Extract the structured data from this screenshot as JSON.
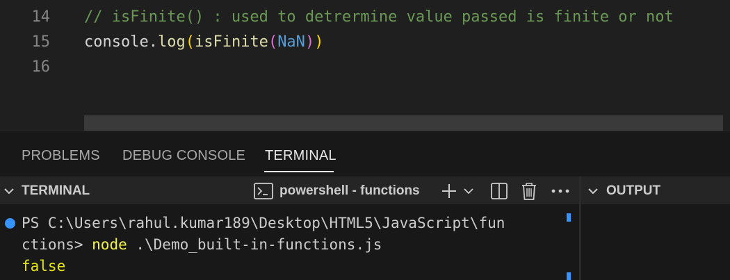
{
  "editor": {
    "lines": [
      {
        "num": "14",
        "comment": "// isFinite() : used to detrermine value passed is finite or not"
      },
      {
        "num": "15",
        "obj": "console",
        "dot": ".",
        "method": "log",
        "open1": "(",
        "fn": "isFinite",
        "open2": "(",
        "arg": "NaN",
        "close2": ")",
        "close1": ")"
      },
      {
        "num": "16"
      }
    ]
  },
  "panel": {
    "tabs": [
      "PROBLEMS",
      "DEBUG CONSOLE",
      "TERMINAL"
    ],
    "active_tab": "TERMINAL",
    "terminal_title": "TERMINAL",
    "shell_label": "powershell - functions",
    "output_title": "OUTPUT",
    "icons": [
      "terminal-icon",
      "plus-icon",
      "chevron-down-icon",
      "split-icon",
      "trash-icon",
      "more-icon"
    ]
  },
  "terminal": {
    "line1": "PS C:\\Users\\rahul.kumar189\\Desktop\\HTML5\\JavaScript\\fun",
    "line2_prefix": "ctions> ",
    "line2_cmd": "node",
    "line2_rest": " .\\Demo_built-in-functions.js",
    "line3": "false"
  },
  "colors": {
    "comment": "#6a9955",
    "function": "#dcdcaa",
    "bracket_outer": "#ffd700",
    "bracket_inner": "#da70d6",
    "keyword": "#569cd6",
    "accent": "#3794ff"
  }
}
